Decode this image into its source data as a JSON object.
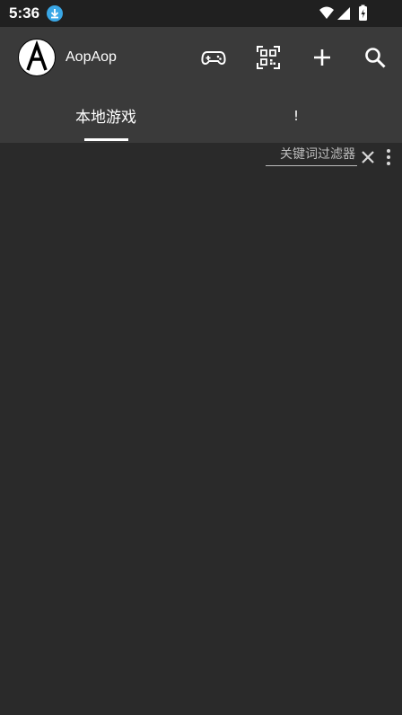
{
  "status_bar": {
    "time": "5:36",
    "icons": [
      "download-icon",
      "wifi-icon",
      "signal-icon",
      "battery-charging-icon"
    ]
  },
  "app_bar": {
    "app_name": "AopAop",
    "logo_letter": "A",
    "actions": [
      "gamepad-icon",
      "qr-scan-icon",
      "add-icon",
      "search-icon"
    ]
  },
  "tabs": [
    {
      "label": "本地游戏",
      "selected": true
    },
    {
      "label": "!",
      "selected": false
    }
  ],
  "filter": {
    "placeholder": "关键词过滤器",
    "value": ""
  },
  "colors": {
    "status_bar_bg": "#202020",
    "app_bar_bg": "#3a3a3a",
    "content_bg": "#2a2a2a",
    "accent_blue": "#3aa7e6"
  }
}
